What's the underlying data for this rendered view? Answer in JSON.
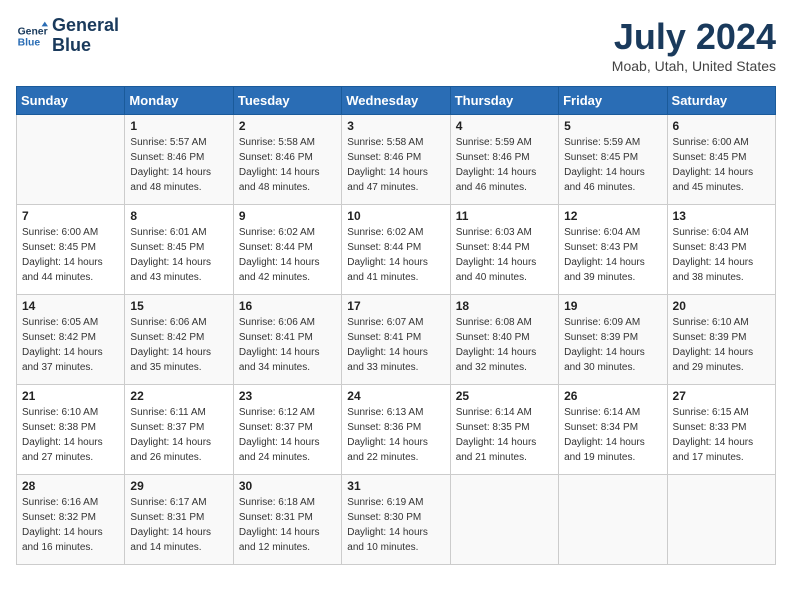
{
  "header": {
    "logo_line1": "General",
    "logo_line2": "Blue",
    "month_year": "July 2024",
    "location": "Moab, Utah, United States"
  },
  "weekdays": [
    "Sunday",
    "Monday",
    "Tuesday",
    "Wednesday",
    "Thursday",
    "Friday",
    "Saturday"
  ],
  "weeks": [
    [
      {
        "day": "",
        "sunrise": "",
        "sunset": "",
        "daylight": ""
      },
      {
        "day": "1",
        "sunrise": "Sunrise: 5:57 AM",
        "sunset": "Sunset: 8:46 PM",
        "daylight": "Daylight: 14 hours and 48 minutes."
      },
      {
        "day": "2",
        "sunrise": "Sunrise: 5:58 AM",
        "sunset": "Sunset: 8:46 PM",
        "daylight": "Daylight: 14 hours and 48 minutes."
      },
      {
        "day": "3",
        "sunrise": "Sunrise: 5:58 AM",
        "sunset": "Sunset: 8:46 PM",
        "daylight": "Daylight: 14 hours and 47 minutes."
      },
      {
        "day": "4",
        "sunrise": "Sunrise: 5:59 AM",
        "sunset": "Sunset: 8:46 PM",
        "daylight": "Daylight: 14 hours and 46 minutes."
      },
      {
        "day": "5",
        "sunrise": "Sunrise: 5:59 AM",
        "sunset": "Sunset: 8:45 PM",
        "daylight": "Daylight: 14 hours and 46 minutes."
      },
      {
        "day": "6",
        "sunrise": "Sunrise: 6:00 AM",
        "sunset": "Sunset: 8:45 PM",
        "daylight": "Daylight: 14 hours and 45 minutes."
      }
    ],
    [
      {
        "day": "7",
        "sunrise": "Sunrise: 6:00 AM",
        "sunset": "Sunset: 8:45 PM",
        "daylight": "Daylight: 14 hours and 44 minutes."
      },
      {
        "day": "8",
        "sunrise": "Sunrise: 6:01 AM",
        "sunset": "Sunset: 8:45 PM",
        "daylight": "Daylight: 14 hours and 43 minutes."
      },
      {
        "day": "9",
        "sunrise": "Sunrise: 6:02 AM",
        "sunset": "Sunset: 8:44 PM",
        "daylight": "Daylight: 14 hours and 42 minutes."
      },
      {
        "day": "10",
        "sunrise": "Sunrise: 6:02 AM",
        "sunset": "Sunset: 8:44 PM",
        "daylight": "Daylight: 14 hours and 41 minutes."
      },
      {
        "day": "11",
        "sunrise": "Sunrise: 6:03 AM",
        "sunset": "Sunset: 8:44 PM",
        "daylight": "Daylight: 14 hours and 40 minutes."
      },
      {
        "day": "12",
        "sunrise": "Sunrise: 6:04 AM",
        "sunset": "Sunset: 8:43 PM",
        "daylight": "Daylight: 14 hours and 39 minutes."
      },
      {
        "day": "13",
        "sunrise": "Sunrise: 6:04 AM",
        "sunset": "Sunset: 8:43 PM",
        "daylight": "Daylight: 14 hours and 38 minutes."
      }
    ],
    [
      {
        "day": "14",
        "sunrise": "Sunrise: 6:05 AM",
        "sunset": "Sunset: 8:42 PM",
        "daylight": "Daylight: 14 hours and 37 minutes."
      },
      {
        "day": "15",
        "sunrise": "Sunrise: 6:06 AM",
        "sunset": "Sunset: 8:42 PM",
        "daylight": "Daylight: 14 hours and 35 minutes."
      },
      {
        "day": "16",
        "sunrise": "Sunrise: 6:06 AM",
        "sunset": "Sunset: 8:41 PM",
        "daylight": "Daylight: 14 hours and 34 minutes."
      },
      {
        "day": "17",
        "sunrise": "Sunrise: 6:07 AM",
        "sunset": "Sunset: 8:41 PM",
        "daylight": "Daylight: 14 hours and 33 minutes."
      },
      {
        "day": "18",
        "sunrise": "Sunrise: 6:08 AM",
        "sunset": "Sunset: 8:40 PM",
        "daylight": "Daylight: 14 hours and 32 minutes."
      },
      {
        "day": "19",
        "sunrise": "Sunrise: 6:09 AM",
        "sunset": "Sunset: 8:39 PM",
        "daylight": "Daylight: 14 hours and 30 minutes."
      },
      {
        "day": "20",
        "sunrise": "Sunrise: 6:10 AM",
        "sunset": "Sunset: 8:39 PM",
        "daylight": "Daylight: 14 hours and 29 minutes."
      }
    ],
    [
      {
        "day": "21",
        "sunrise": "Sunrise: 6:10 AM",
        "sunset": "Sunset: 8:38 PM",
        "daylight": "Daylight: 14 hours and 27 minutes."
      },
      {
        "day": "22",
        "sunrise": "Sunrise: 6:11 AM",
        "sunset": "Sunset: 8:37 PM",
        "daylight": "Daylight: 14 hours and 26 minutes."
      },
      {
        "day": "23",
        "sunrise": "Sunrise: 6:12 AM",
        "sunset": "Sunset: 8:37 PM",
        "daylight": "Daylight: 14 hours and 24 minutes."
      },
      {
        "day": "24",
        "sunrise": "Sunrise: 6:13 AM",
        "sunset": "Sunset: 8:36 PM",
        "daylight": "Daylight: 14 hours and 22 minutes."
      },
      {
        "day": "25",
        "sunrise": "Sunrise: 6:14 AM",
        "sunset": "Sunset: 8:35 PM",
        "daylight": "Daylight: 14 hours and 21 minutes."
      },
      {
        "day": "26",
        "sunrise": "Sunrise: 6:14 AM",
        "sunset": "Sunset: 8:34 PM",
        "daylight": "Daylight: 14 hours and 19 minutes."
      },
      {
        "day": "27",
        "sunrise": "Sunrise: 6:15 AM",
        "sunset": "Sunset: 8:33 PM",
        "daylight": "Daylight: 14 hours and 17 minutes."
      }
    ],
    [
      {
        "day": "28",
        "sunrise": "Sunrise: 6:16 AM",
        "sunset": "Sunset: 8:32 PM",
        "daylight": "Daylight: 14 hours and 16 minutes."
      },
      {
        "day": "29",
        "sunrise": "Sunrise: 6:17 AM",
        "sunset": "Sunset: 8:31 PM",
        "daylight": "Daylight: 14 hours and 14 minutes."
      },
      {
        "day": "30",
        "sunrise": "Sunrise: 6:18 AM",
        "sunset": "Sunset: 8:31 PM",
        "daylight": "Daylight: 14 hours and 12 minutes."
      },
      {
        "day": "31",
        "sunrise": "Sunrise: 6:19 AM",
        "sunset": "Sunset: 8:30 PM",
        "daylight": "Daylight: 14 hours and 10 minutes."
      },
      {
        "day": "",
        "sunrise": "",
        "sunset": "",
        "daylight": ""
      },
      {
        "day": "",
        "sunrise": "",
        "sunset": "",
        "daylight": ""
      },
      {
        "day": "",
        "sunrise": "",
        "sunset": "",
        "daylight": ""
      }
    ]
  ]
}
